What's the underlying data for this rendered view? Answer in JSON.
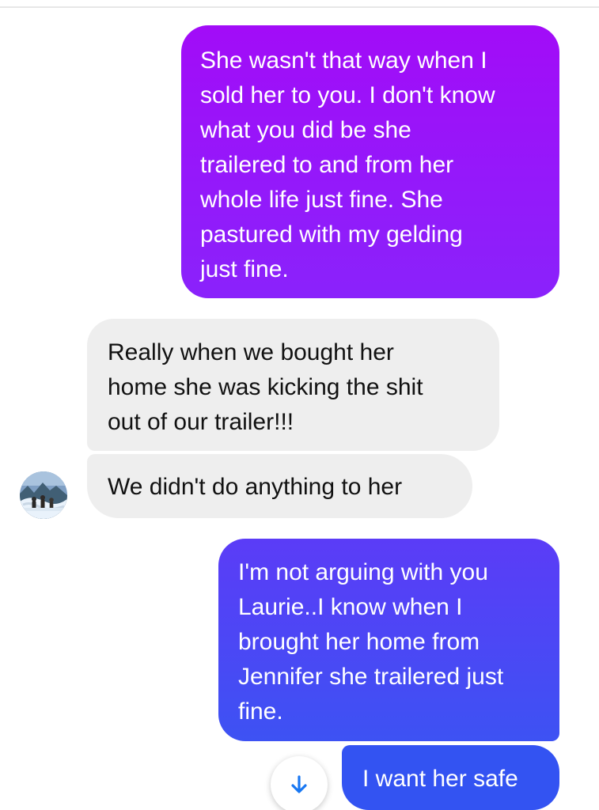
{
  "messages": [
    {
      "direction": "sent",
      "text": "She wasn't that way when I\nsold her to you. I don't know\nwhat you did be she\ntrailered to and from her\nwhole life just fine. She\npastured with my gelding\njust fine."
    },
    {
      "direction": "received",
      "text": "Really when we bought her\nhome she was kicking the shit\nout of our trailer!!!"
    },
    {
      "direction": "received",
      "text": "We didn't do anything to her"
    },
    {
      "direction": "sent",
      "text": "I'm not arguing with you\nLaurie..I know when I\nbrought her home from\nJennifer she trailered just\nfine."
    },
    {
      "direction": "sent",
      "text": "I want her safe"
    }
  ],
  "contact": {
    "avatar_icon": "profile-photo-icon"
  },
  "controls": {
    "scroll_down_icon": "arrow-down-icon"
  },
  "colors": {
    "sent_gradient_top": "#a20cf8",
    "sent_gradient_bottom": "#8a22fb",
    "sent_blue_top": "#5b3cf7",
    "sent_blue_bottom": "#3d52f3",
    "received_bubble": "#eeeeee",
    "received_text": "#111111",
    "arrow_blue": "#1877f2"
  }
}
